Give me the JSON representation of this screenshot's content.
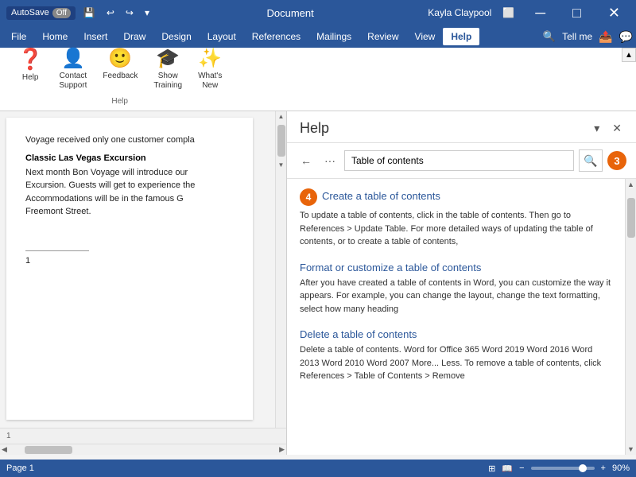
{
  "titlebar": {
    "autosave_label": "AutoSave",
    "autosave_state": "Off",
    "title": "Document",
    "user": "Kayla Claypool",
    "minimize_icon": "─",
    "restore_icon": "□",
    "close_icon": "✕"
  },
  "menubar": {
    "items": [
      {
        "label": "File",
        "active": false
      },
      {
        "label": "Home",
        "active": false
      },
      {
        "label": "Insert",
        "active": false
      },
      {
        "label": "Draw",
        "active": false
      },
      {
        "label": "Design",
        "active": false
      },
      {
        "label": "Layout",
        "active": false
      },
      {
        "label": "References",
        "active": false
      },
      {
        "label": "Mailings",
        "active": false
      },
      {
        "label": "Review",
        "active": false
      },
      {
        "label": "View",
        "active": false
      },
      {
        "label": "Help",
        "active": true
      }
    ],
    "search_label": "Tell me",
    "search_icon": "🔍"
  },
  "ribbon": {
    "group_label": "Help",
    "buttons": [
      {
        "label": "Help",
        "icon": "?",
        "id": "help-btn"
      },
      {
        "label": "Contact\nSupport",
        "icon": "👤",
        "id": "contact-support-btn"
      },
      {
        "label": "Feedback",
        "icon": "😊",
        "id": "feedback-btn"
      },
      {
        "label": "Show\nTraining",
        "icon": "🎓",
        "id": "show-training-btn"
      },
      {
        "label": "What's\nNew",
        "icon": "✨",
        "id": "whats-new-btn"
      }
    ]
  },
  "document": {
    "text_intro": "Voyage received only one customer compla",
    "heading": "Classic Las Vegas Excursion",
    "body": "Next month Bon Voyage will introduce our Excursion. Guests will get to experience the Accommodations will be in the famous G Freemont Street.",
    "page_indicator": "1"
  },
  "help_panel": {
    "title": "Help",
    "search_placeholder": "Table of contents",
    "step_badge": "3",
    "step_badge_4": "4",
    "back_icon": "←",
    "more_icon": "···",
    "search_icon": "🔍",
    "collapse_icon": "▾",
    "close_icon": "✕",
    "articles": [
      {
        "title": "Create a table of contents",
        "desc": "To update a table of contents, click in the table of contents. Then go to References > Update Table. For more detailed ways of updating the table of contents, or to create a table of contents,"
      },
      {
        "title": "Format or customize a table of contents",
        "desc": "After you have created a table of contents in Word, you can customize the way it appears. For example, you can change the layout, change the text formatting, select how many heading"
      },
      {
        "title": "Delete a table of contents",
        "desc": "Delete a table of contents. Word for Office 365 Word 2019 Word 2016 Word 2013 Word 2010 Word 2007 More... Less. To remove a table of contents, click References > Table of Contents > Remove"
      }
    ]
  },
  "statusbar": {
    "page_info": "1",
    "word_count": "",
    "zoom_level": "90%",
    "zoom_icon": "+",
    "zoom_minus": "−"
  }
}
